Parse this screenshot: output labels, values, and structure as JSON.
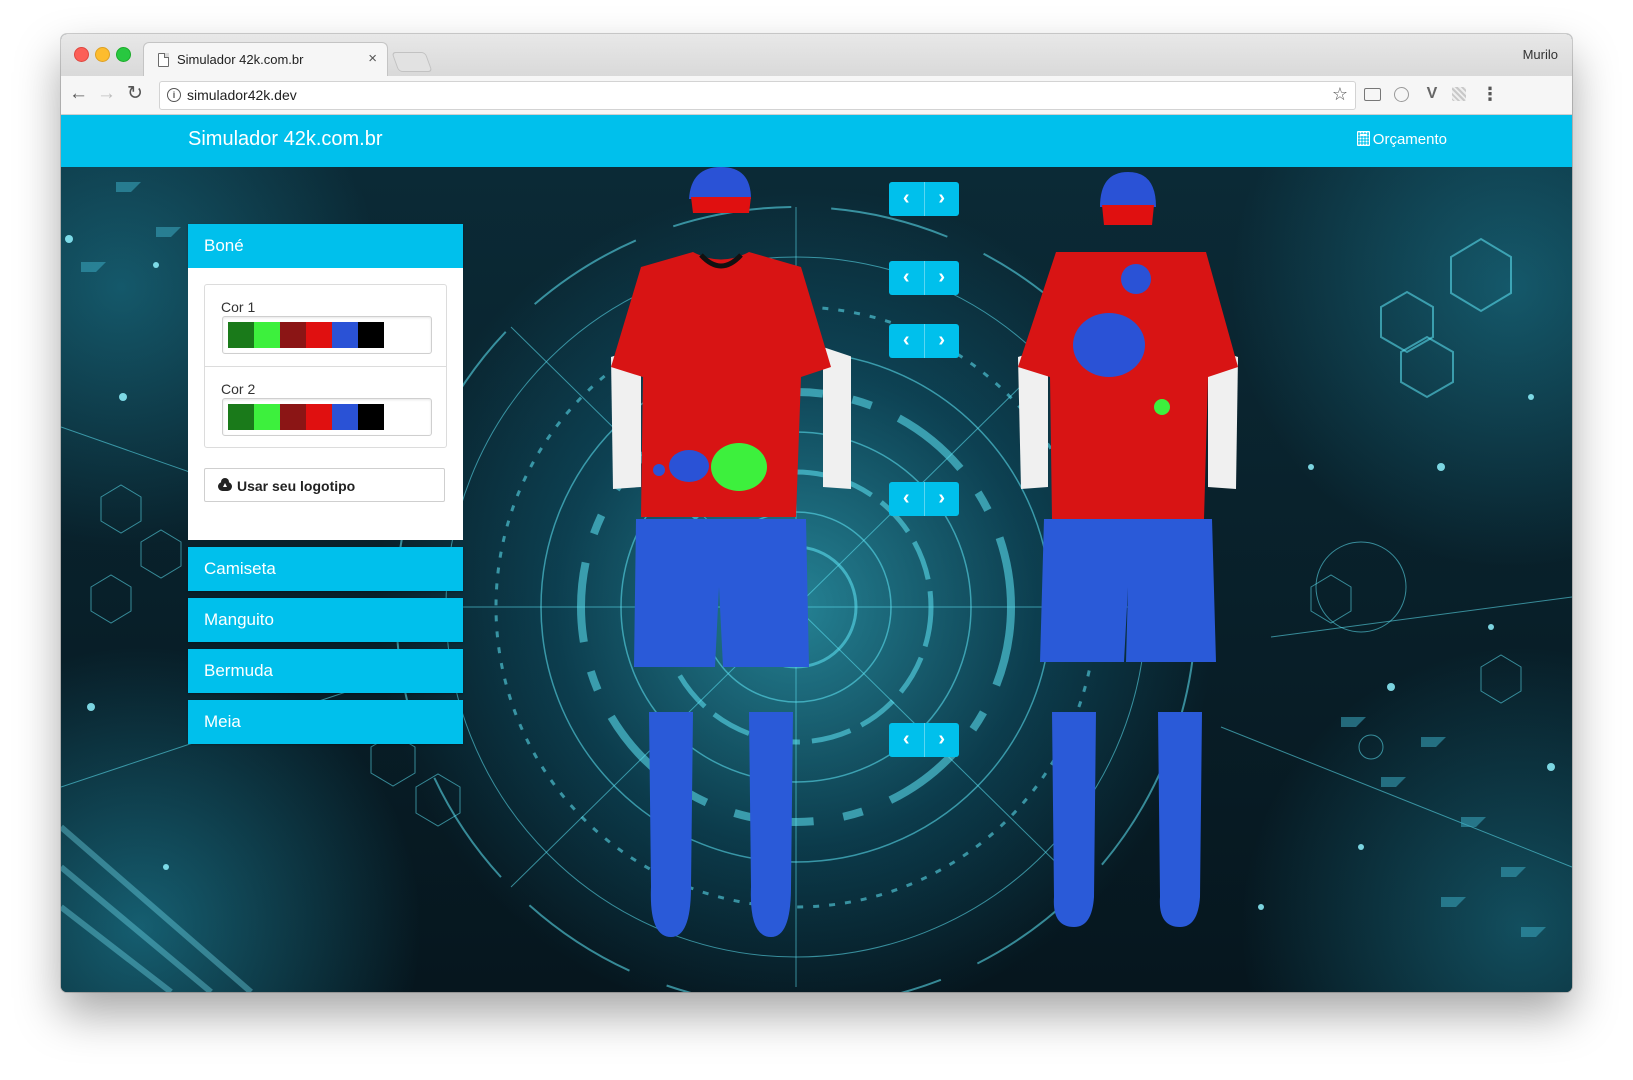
{
  "browser": {
    "tab_title": "Simulador 42k.com.br",
    "tab_close": "×",
    "profile_name": "Murilo",
    "url": "simulador42k.dev",
    "nav": {
      "back": "←",
      "forward": "→",
      "reload": "↻",
      "star": "☆",
      "menu": "⋮",
      "info": "i"
    }
  },
  "navbar": {
    "brand": "Simulador 42k.com.br",
    "budget_link": "Orçamento"
  },
  "accordion": {
    "sections": [
      {
        "label": "Boné",
        "open": true
      },
      {
        "label": "Camiseta",
        "open": false
      },
      {
        "label": "Manguito",
        "open": false
      },
      {
        "label": "Bermuda",
        "open": false
      },
      {
        "label": "Meia",
        "open": false
      }
    ],
    "color_pickers": [
      {
        "label": "Cor 1",
        "swatches": [
          "#1a7a1a",
          "#3df03d",
          "#8b1515",
          "#e01010",
          "#2a52d6",
          "#000000"
        ]
      },
      {
        "label": "Cor 2",
        "swatches": [
          "#1a7a1a",
          "#3df03d",
          "#8b1515",
          "#e01010",
          "#2a52d6",
          "#000000"
        ]
      }
    ],
    "logo_button": "Usar seu logotipo"
  },
  "arrow_controls": {
    "prev": "‹",
    "next": "›"
  },
  "uniform": {
    "colors": {
      "cap": "#2a52d6",
      "cap_visor": "#e01010",
      "shirt": "#d81414",
      "sleeves": "#f0f0f0",
      "shorts": "#2a5ad8",
      "socks": "#2a5ad8",
      "accent": "#00c0ec"
    }
  }
}
